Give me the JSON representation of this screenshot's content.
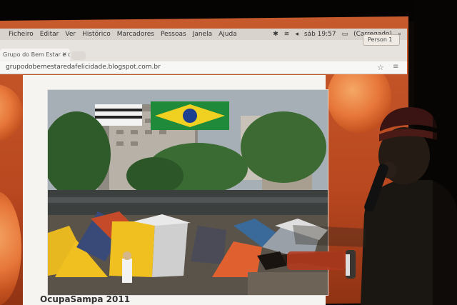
{
  "menubar": {
    "items": [
      "Ficheiro",
      "Editar",
      "Ver",
      "Histórico",
      "Marcadores",
      "Pessoas",
      "Janela",
      "Ajuda"
    ],
    "clock": "sáb 19:57",
    "battery": "(Carregado)"
  },
  "browser": {
    "tab_title": "Grupo do Bem Estar e da",
    "profile_label": "Person 1",
    "url": "grupodobemestaredafelicidade.blogspot.com.br"
  },
  "page": {
    "caption": "OcupaSampa 2011"
  },
  "icons": [
    "search-icon",
    "wifi-icon",
    "bluetooth-icon",
    "volume-icon",
    "battery-icon",
    "star-icon",
    "menu-icon",
    "close-icon",
    "microphone-icon"
  ],
  "colors": {
    "projection": "#c75a2c",
    "orb": "#e7773a",
    "tent_yellow": "#f0c020",
    "flag_green": "#1f8a3a"
  }
}
